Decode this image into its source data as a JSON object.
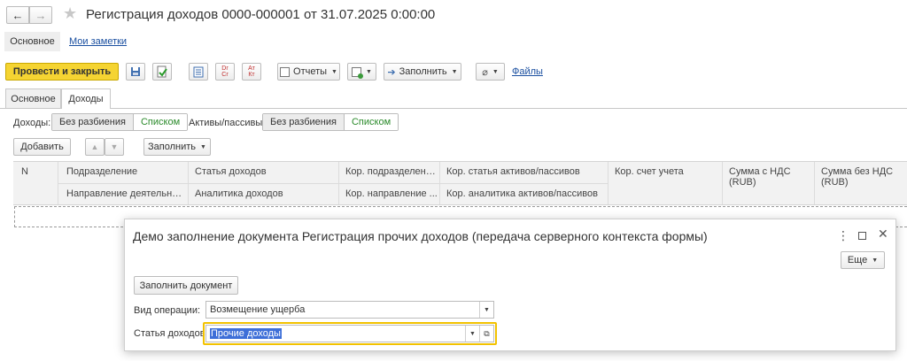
{
  "window": {
    "title": "Регистрация доходов 0000-000001 от 31.07.2025 0:00:00",
    "nav_tabs": [
      "Основное",
      "Мои заметки"
    ]
  },
  "toolbar": {
    "primary": "Провести и закрыть",
    "reports": "Отчеты",
    "fill": "Заполнить",
    "files": "Файлы"
  },
  "tabs": [
    "Основное",
    "Доходы"
  ],
  "filters": {
    "income_label": "Доходы:",
    "assets_label": "Активы/пассивы:",
    "no_split": "Без разбиения",
    "list": "Списком"
  },
  "table_toolbar": {
    "add": "Добавить",
    "fill": "Заполнить"
  },
  "table": {
    "headers_row1": [
      "N",
      "Подразделение",
      "Статья доходов",
      "Кор. подразделение",
      "Кор. статья активов/пассивов",
      "Кор. счет учета",
      "Сумма с НДС (RUB)",
      "Сумма без НДС (RUB)"
    ],
    "headers_row2": [
      "Направление деятельности",
      "Аналитика доходов",
      "Кор. направление ...",
      "Кор. аналитика активов/пассивов"
    ]
  },
  "dialog": {
    "title": "Демо заполнение документа Регистрация прочих доходов (передача серверного контекста формы)",
    "more": "Еще",
    "fill_button": "Заполнить документ",
    "op_label": "Вид операции:",
    "op_value": "Возмещение ущерба",
    "item_label": "Статья доходов:",
    "item_value": "Прочие доходы"
  },
  "colors": {
    "primary_yellow": "#f5d432",
    "link_blue": "#1a4fa0",
    "focus_yellow": "#f2c200",
    "selection_blue": "#3e6fd8",
    "green": "#2a8a2a"
  }
}
